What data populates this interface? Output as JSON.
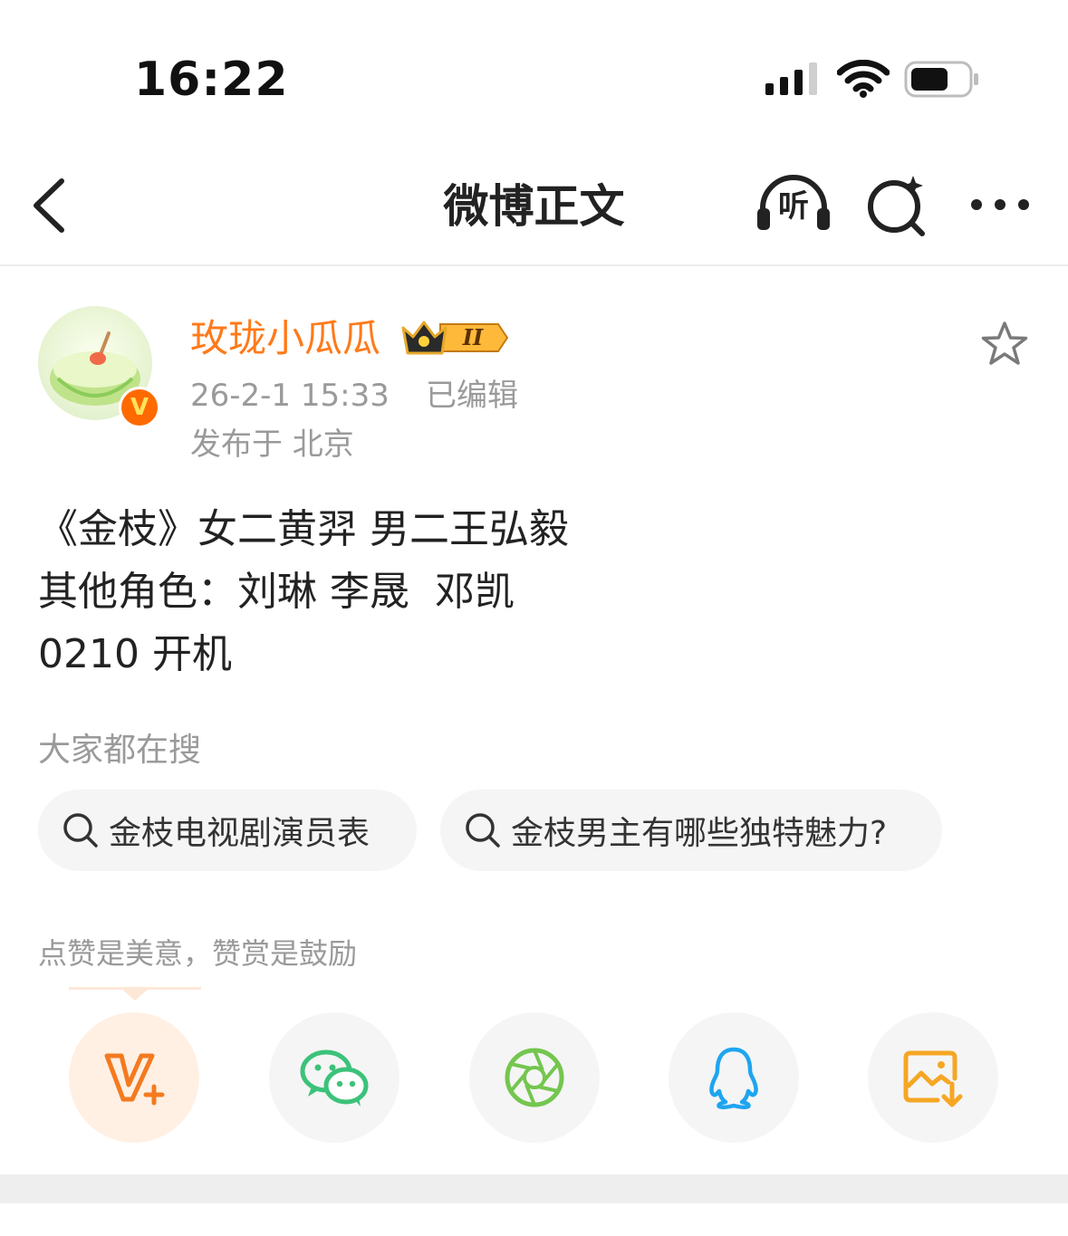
{
  "status_bar": {
    "time": "16:22",
    "icons": [
      "cellular-signal-icon",
      "wifi-icon",
      "battery-icon"
    ]
  },
  "nav": {
    "title": "微博正文",
    "listen_label": "听",
    "icons": [
      "back-chevron-icon",
      "listen-headphones-icon",
      "ai-search-sparkle-icon",
      "more-dots-icon"
    ]
  },
  "author": {
    "name": "玫珑小瓜瓜",
    "level_badge": "II",
    "verified_label": "V",
    "time": "26-2-1 15:33",
    "edited": "已编辑",
    "location": "发布于 北京"
  },
  "post": {
    "lines": [
      "《金枝》女二黄羿 男二王弘毅",
      "其他角色：刘琳 李晟  邓凯",
      "0210 开机"
    ]
  },
  "search": {
    "title": "大家都在搜",
    "chips": [
      "金枝电视剧演员表",
      "金枝男主有哪些独特魅力?"
    ]
  },
  "reward": {
    "note": "点赞是美意，赞赏是鼓励"
  },
  "share": {
    "items": [
      {
        "name": "reward-v-plus",
        "icon": "v-plus-icon",
        "color": "#f47a20"
      },
      {
        "name": "wechat",
        "icon": "wechat-icon",
        "color": "#3cc27a"
      },
      {
        "name": "moments",
        "icon": "moments-aperture-icon",
        "color": "#74c64f"
      },
      {
        "name": "qq",
        "icon": "qq-penguin-icon",
        "color": "#1ea5f0"
      },
      {
        "name": "save-image",
        "icon": "save-image-icon",
        "color": "#f5a623"
      }
    ]
  },
  "colors": {
    "accent_orange": "#ff7a1a",
    "meta_gray": "#9a9a9a",
    "chip_bg": "#f5f5f5"
  }
}
